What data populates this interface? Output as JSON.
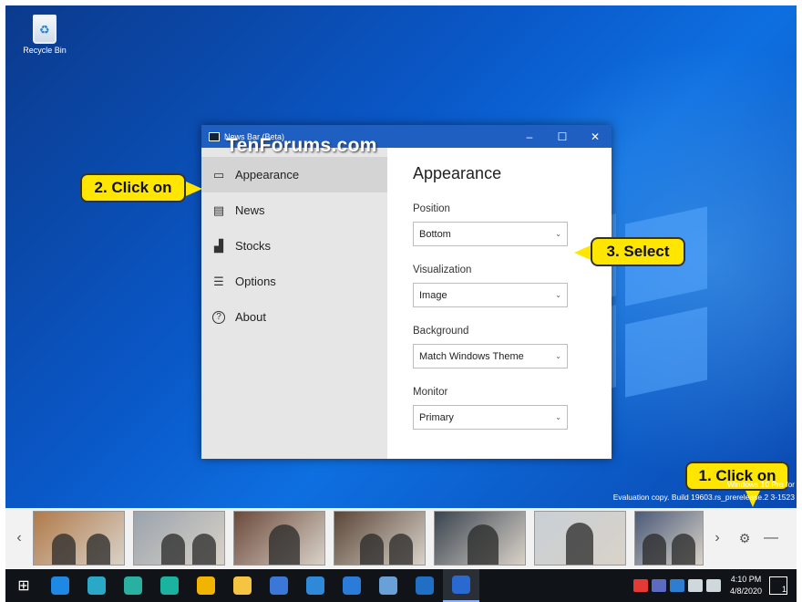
{
  "desktop": {
    "recycle_bin_label": "Recycle Bin",
    "watermark": "TenForums.com",
    "eval_line1": "Windows 10 Pro for",
    "eval_line2": "Evaluation copy. Build 19603.rs_prerelease.2   3-1523"
  },
  "window": {
    "title": "News Bar (Beta)",
    "minimize": "–",
    "maximize": "☐",
    "close": "✕",
    "nav": [
      {
        "label": "Appearance",
        "icon": "monitor-icon",
        "glyph": "▭",
        "active": true
      },
      {
        "label": "News",
        "icon": "news-icon",
        "glyph": "▤",
        "active": false
      },
      {
        "label": "Stocks",
        "icon": "stocks-icon",
        "glyph": "▟",
        "active": false
      },
      {
        "label": "Options",
        "icon": "sliders-icon",
        "glyph": "☰",
        "active": false
      },
      {
        "label": "About",
        "icon": "help-icon",
        "glyph": "?",
        "active": false
      }
    ],
    "content": {
      "heading": "Appearance",
      "fields": [
        {
          "label": "Position",
          "value": "Bottom"
        },
        {
          "label": "Visualization",
          "value": "Image"
        },
        {
          "label": "Background",
          "value": "Match Windows Theme"
        },
        {
          "label": "Monitor",
          "value": "Primary"
        }
      ]
    }
  },
  "callouts": {
    "step1": "1. Click on",
    "step2": "2. Click on",
    "step3": "3. Select"
  },
  "newsbar": {
    "prev": "‹",
    "next": "›",
    "gear": "⚙",
    "hide": "—",
    "thumb_colors": [
      "#b07a4a",
      "#9aa3ad",
      "#6b4a3a",
      "#5a4638",
      "#3a4450",
      "#c8cfd6",
      "#4a5a78"
    ]
  },
  "taskbar": {
    "start": "⊞",
    "apps": [
      "#1e88e5",
      "#2aa8c8",
      "#2ab0a0",
      "#19b3a0",
      "#f2b400",
      "#f5c542",
      "#3a77d6",
      "#2e8ad8",
      "#2b7bd9",
      "#6aa0d8",
      "#1f6fc4",
      "#2a6ad0"
    ],
    "tray_colors": [
      "#e53935",
      "#5c6bc0",
      "#2e7dd1",
      "#cfd8dc",
      "#cfd8dc"
    ],
    "time": "4:10 PM",
    "date": "4/8/2020",
    "notif_count": "1"
  }
}
